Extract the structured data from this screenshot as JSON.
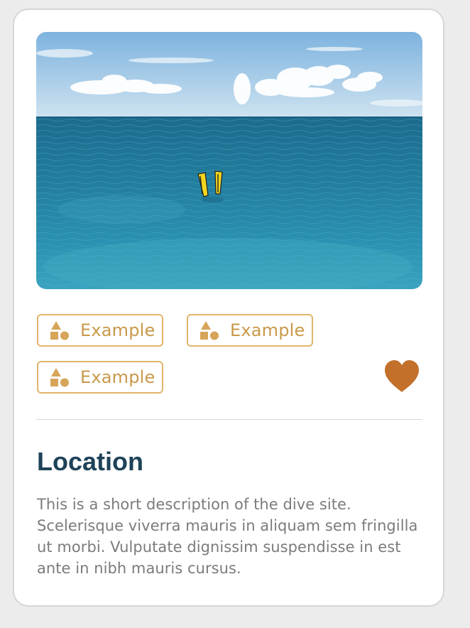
{
  "card": {
    "image_alt": "Snorkeler's yellow fins above turquoise sea water",
    "tags": [
      {
        "label": "Example",
        "icon": "shapes-icon"
      },
      {
        "label": "Example",
        "icon": "shapes-icon"
      },
      {
        "label": "Example",
        "icon": "shapes-icon"
      }
    ],
    "favorite_icon": "heart-icon",
    "title": "Location",
    "description": "This is a short description of the dive site. Scelerisque viverra mauris in aliquam sem fringilla ut morbi. Vulputate dignissim suspendisse in est ante in nibh mauris cursus."
  },
  "colors": {
    "tag_accent": "#c9994a",
    "tag_border": "#e0b66a",
    "heart": "#c2702a",
    "title": "#1e4258",
    "body_text": "#7b7b7b"
  }
}
